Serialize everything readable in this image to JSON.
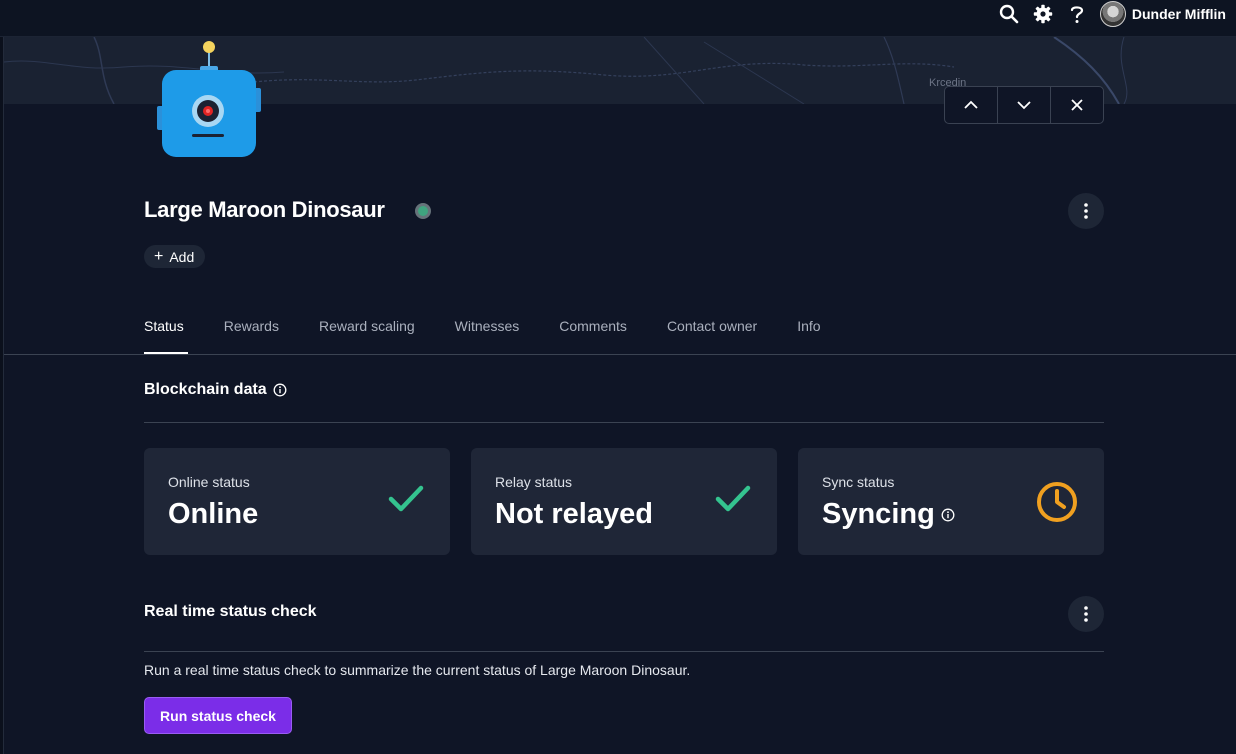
{
  "header": {
    "user_name": "Dunder Mifflin",
    "icons": [
      "search-icon",
      "gear-icon",
      "help-icon",
      "avatar"
    ]
  },
  "map": {
    "place_label": "Krcedin"
  },
  "hotspot": {
    "name": "Large Maroon Dinosaur",
    "status_color": "#3fa47f",
    "add_label": "Add"
  },
  "tabs": [
    {
      "label": "Status",
      "active": true
    },
    {
      "label": "Rewards",
      "active": false
    },
    {
      "label": "Reward scaling",
      "active": false
    },
    {
      "label": "Witnesses",
      "active": false
    },
    {
      "label": "Comments",
      "active": false
    },
    {
      "label": "Contact owner",
      "active": false
    },
    {
      "label": "Info",
      "active": false
    }
  ],
  "blockchain": {
    "title": "Blockchain data",
    "cards": [
      {
        "label": "Online status",
        "value": "Online",
        "icon": "check-icon",
        "icon_color": "#34c38f"
      },
      {
        "label": "Relay status",
        "value": "Not relayed",
        "icon": "check-icon",
        "icon_color": "#34c38f"
      },
      {
        "label": "Sync status",
        "value": "Syncing",
        "icon": "clock-icon",
        "icon_color": "#f0a020"
      }
    ]
  },
  "realtime": {
    "title": "Real time status check",
    "description": "Run a real time status check to summarize the current status of Large Maroon Dinosaur.",
    "button_label": "Run status check"
  },
  "colors": {
    "background": "#0f1526",
    "card": "#1f2637",
    "accent_purple": "#7b2de8"
  }
}
